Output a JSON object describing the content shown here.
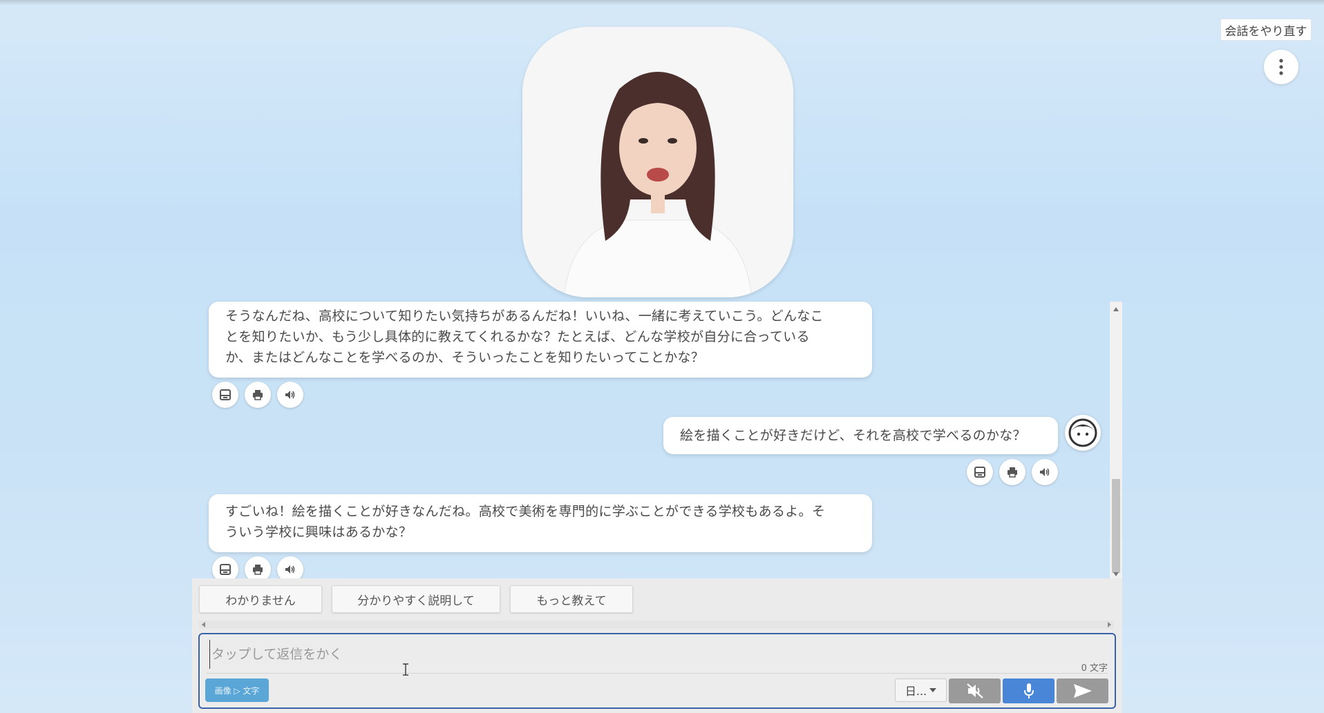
{
  "header": {
    "restart_label": "会話をやり直す",
    "menu_icon": "more-vert-icon"
  },
  "conversation": {
    "messages": [
      {
        "role": "assistant",
        "lines": [
          "そうなんだね、高校について知りたい気持ちがあるんだね！いいね、一緒に考えていこう。どんなこ",
          "とを知りたいか、もう少し具体的に教えてくれるかな？たとえば、どんな学校が自分に合っている",
          "か、またはどんなことを学べるのか、そういったことを知りたいってことかな？"
        ],
        "actions": [
          "save-icon",
          "print-icon",
          "speaker-icon"
        ]
      },
      {
        "role": "user",
        "lines": [
          "絵を描くことが好きだけど、それを高校で学べるのかな？"
        ],
        "actions": [
          "save-icon",
          "print-icon",
          "speaker-icon"
        ]
      },
      {
        "role": "assistant",
        "lines": [
          "すごいね！絵を描くことが好きなんだね。高校で美術を専門的に学ぶことができる学校もあるよ。そ",
          "ういう学校に興味はあるかな？"
        ],
        "actions": [
          "save-icon",
          "print-icon",
          "speaker-icon"
        ]
      }
    ]
  },
  "quick_replies": [
    "わかりません",
    "分かりやすく説明して",
    "もっと教えて"
  ],
  "composer": {
    "placeholder": "タップして返信をかく",
    "char_count": "0 文字",
    "image_to_text_label": "画像 ▷ 文字",
    "language_label": "日...",
    "mute_icon": "speaker-muted-icon",
    "mic_icon": "microphone-icon",
    "send_icon": "send-icon"
  },
  "colors": {
    "accent_border": "#3a62a8",
    "mic_button": "#4a86d8",
    "image_text_button": "#5aa6d6"
  }
}
